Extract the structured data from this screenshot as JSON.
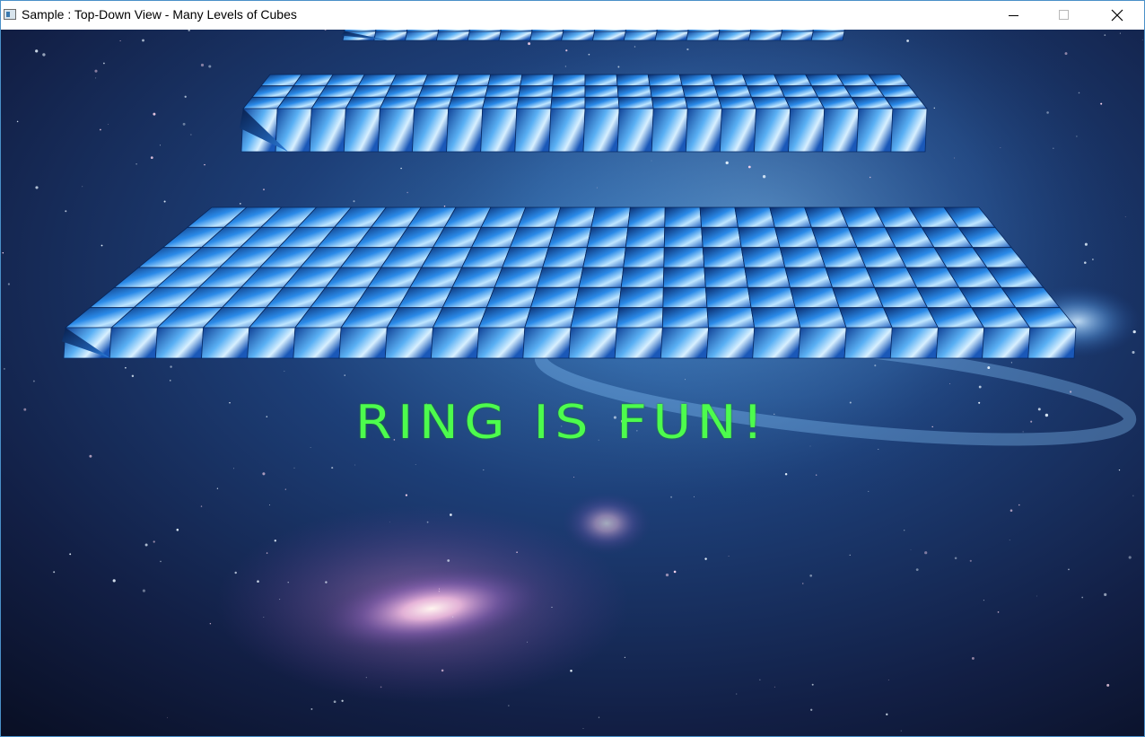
{
  "window": {
    "title": "Sample : Top-Down View - Many Levels of Cubes",
    "controls": {
      "minimize_icon": "minimize-icon",
      "maximize_icon": "maximize-icon",
      "close_icon": "close-icon"
    }
  },
  "scene": {
    "banner_text": "RING IS FUN!",
    "banner_color": "#4dfc4d",
    "background": "space-nebula-galaxy",
    "cube_colors": {
      "light": "#7fc4ff",
      "mid": "#1f6fd0",
      "dark": "#08204f"
    },
    "levels": [
      {
        "name": "level-top",
        "rows": 1
      },
      {
        "name": "level-middle",
        "rows": 3
      },
      {
        "name": "level-bottom",
        "rows": 6
      }
    ]
  }
}
